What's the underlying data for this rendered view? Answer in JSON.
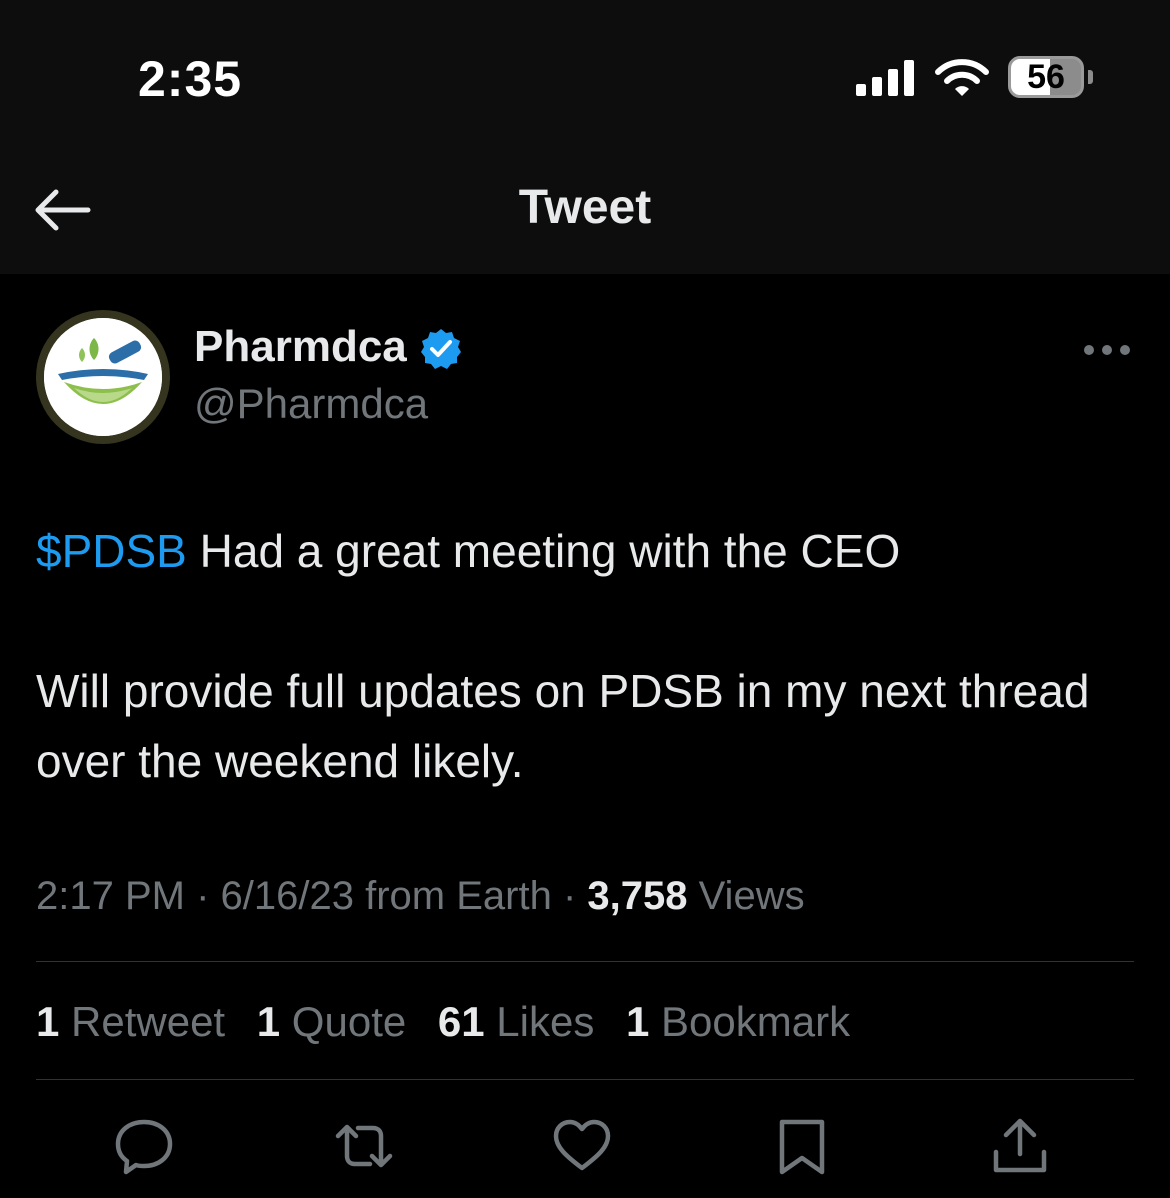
{
  "status_bar": {
    "time": "2:35",
    "battery_level": "56",
    "battery_percent": 56,
    "signal_bars": 4,
    "icons": [
      "cellular-signal-icon",
      "wifi-icon",
      "battery-icon"
    ]
  },
  "nav": {
    "title": "Tweet",
    "back_icon": "back-arrow-icon"
  },
  "author": {
    "display_name": "Pharmdca",
    "handle": "@Pharmdca",
    "verified": true,
    "verified_color": "#1d9bf0"
  },
  "tweet": {
    "cashtag": "$PDSB",
    "line1_rest": " Had a great meeting with the CEO",
    "paragraph2": "Will provide full updates on PDSB in my next thread over the weekend likely."
  },
  "meta": {
    "time": "2:17 PM",
    "separator": " · ",
    "date": "6/16/23",
    "source": " from Earth",
    "views_count": "3,758",
    "views_label": " Views"
  },
  "stats": [
    {
      "count": "1",
      "label": " Retweet"
    },
    {
      "count": "1",
      "label": " Quote"
    },
    {
      "count": "61",
      "label": " Likes"
    },
    {
      "count": "1",
      "label": " Bookmark"
    }
  ],
  "actions": [
    "reply-icon",
    "retweet-icon",
    "like-icon",
    "bookmark-icon",
    "share-icon"
  ],
  "colors": {
    "background": "#000000",
    "header_bg": "#0d0d0d",
    "primary_text": "#e7e9ea",
    "secondary_text": "#71767b",
    "link": "#1d9bf0",
    "divider": "#2f3336"
  }
}
